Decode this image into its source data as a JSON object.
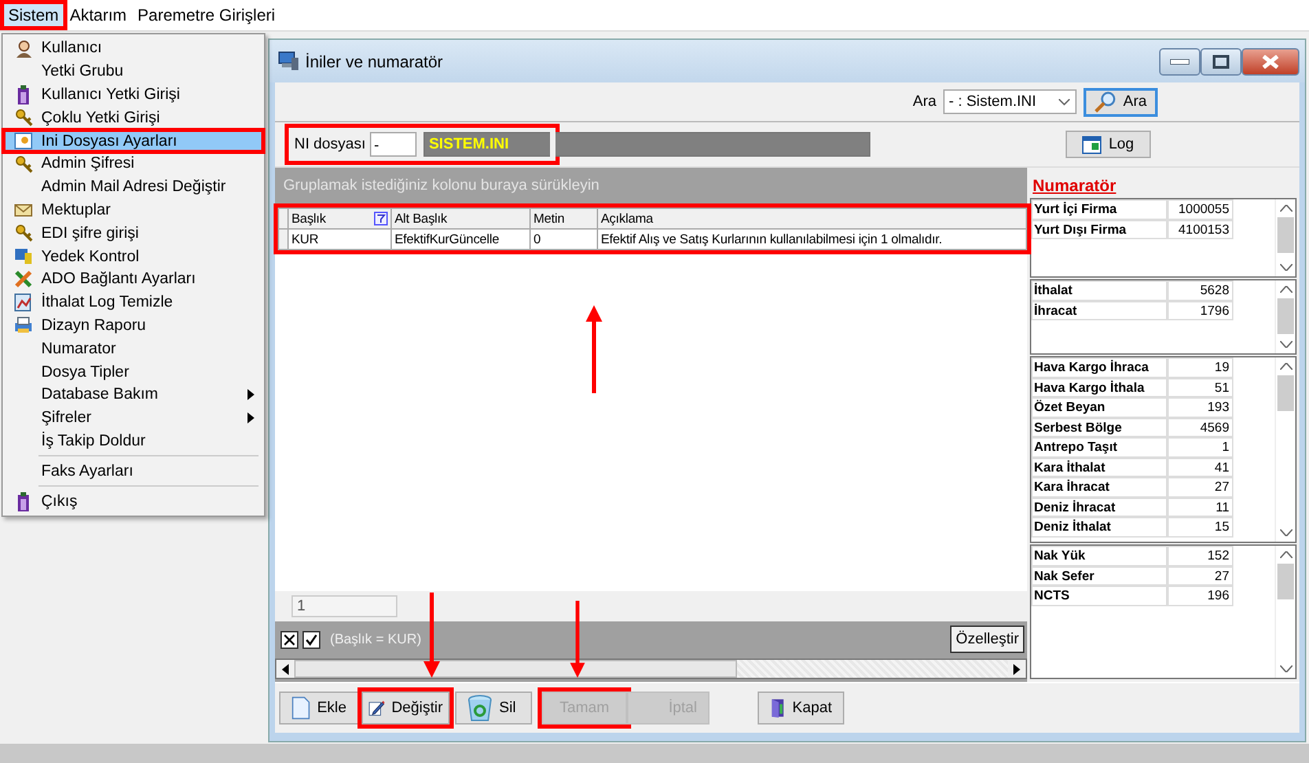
{
  "menu_bar": [
    {
      "label": "Sistem",
      "selected": true,
      "highlighted": true
    },
    {
      "label": "Aktarım",
      "selected": false,
      "highlighted": false
    },
    {
      "label": "Paremetre Girişleri",
      "selected": false,
      "highlighted": false
    }
  ],
  "menu": [
    {
      "kind": "item",
      "label": "Kullanıcı",
      "icon": true,
      "submenu": false,
      "selected": false,
      "highlighted": false
    },
    {
      "kind": "item",
      "label": "Yetki Grubu",
      "icon": false,
      "submenu": false,
      "selected": false,
      "highlighted": false
    },
    {
      "kind": "item",
      "label": "Kullanıcı Yetki Girişi",
      "icon": true,
      "submenu": false,
      "selected": false,
      "highlighted": false
    },
    {
      "kind": "item",
      "label": "Çoklu Yetki Girişi",
      "icon": true,
      "submenu": false,
      "selected": false,
      "highlighted": false
    },
    {
      "kind": "item",
      "label": "Ini Dosyası  Ayarları",
      "icon": true,
      "submenu": false,
      "selected": true,
      "highlighted": true
    },
    {
      "kind": "item",
      "label": "Admin Şifresi",
      "icon": true,
      "submenu": false,
      "selected": false,
      "highlighted": false
    },
    {
      "kind": "item",
      "label": "Admin Mail Adresi Değiştir",
      "icon": false,
      "submenu": false,
      "selected": false,
      "highlighted": false
    },
    {
      "kind": "item",
      "label": "Mektuplar",
      "icon": true,
      "submenu": false,
      "selected": false,
      "highlighted": false
    },
    {
      "kind": "item",
      "label": "EDI şifre girişi",
      "icon": true,
      "submenu": false,
      "selected": false,
      "highlighted": false
    },
    {
      "kind": "item",
      "label": "Yedek Kontrol",
      "icon": true,
      "submenu": false,
      "selected": false,
      "highlighted": false
    },
    {
      "kind": "item",
      "label": "ADO Bağlantı Ayarları",
      "icon": true,
      "submenu": false,
      "selected": false,
      "highlighted": false
    },
    {
      "kind": "item",
      "label": "İthalat Log Temizle",
      "icon": true,
      "submenu": false,
      "selected": false,
      "highlighted": false
    },
    {
      "kind": "item",
      "label": "Dizayn Raporu",
      "icon": true,
      "submenu": false,
      "selected": false,
      "highlighted": false
    },
    {
      "kind": "item",
      "label": "Numarator",
      "icon": false,
      "submenu": false,
      "selected": false,
      "highlighted": false
    },
    {
      "kind": "item",
      "label": "Dosya Tipler",
      "icon": false,
      "submenu": false,
      "selected": false,
      "highlighted": false
    },
    {
      "kind": "item",
      "label": "Database Bakım",
      "icon": false,
      "submenu": true,
      "selected": false,
      "highlighted": false
    },
    {
      "kind": "item",
      "label": "Şifreler",
      "icon": false,
      "submenu": true,
      "selected": false,
      "highlighted": false
    },
    {
      "kind": "item",
      "label": "İş Takip Doldur",
      "icon": false,
      "submenu": false,
      "selected": false,
      "highlighted": false
    },
    {
      "kind": "separator"
    },
    {
      "kind": "item",
      "label": "Faks Ayarları",
      "icon": false,
      "submenu": false,
      "selected": false,
      "highlighted": false
    },
    {
      "kind": "separator"
    },
    {
      "kind": "item",
      "label": "Çıkış",
      "icon": true,
      "submenu": false,
      "selected": false,
      "highlighted": false
    }
  ],
  "window": {
    "title": "İniler ve numaratör",
    "search": {
      "label": "Ara",
      "value": "- : Sistem.INI",
      "button": "Ara"
    },
    "ini": {
      "label": "NI dosyası",
      "value": "-",
      "file": "SISTEM.INI",
      "highlighted": true
    },
    "log_button": "Log",
    "grid": {
      "group_hint": "Gruplamak istediğiniz kolonu buraya sürükleyin",
      "highlighted": true,
      "arrow": true,
      "columns": [
        "Başlık",
        "Alt Başlık",
        "Metin",
        "Açıklama"
      ],
      "rows": [
        [
          "KUR",
          "EfektifKurGüncelle",
          "0",
          "Efektif Alış ve Satış Kurlarının kullanılabilmesi için 1 olmalıdır."
        ]
      ],
      "footer": "1",
      "filter": {
        "checked": true,
        "text": "(Başlık = KUR)",
        "button": "Özelleştir"
      }
    },
    "buttons": [
      {
        "label": "Ekle",
        "disabled": false,
        "highlighted": false,
        "arrow": false
      },
      {
        "label": "Değiştir",
        "disabled": false,
        "highlighted": true,
        "arrow": true
      },
      {
        "label": "Sil",
        "disabled": false,
        "highlighted": false,
        "arrow": false
      },
      {
        "label": "Tamam",
        "disabled": true,
        "highlighted": true,
        "arrow": true
      },
      {
        "label": "İptal",
        "disabled": true,
        "highlighted": false,
        "arrow": false
      },
      {
        "label": "Kapat",
        "disabled": false,
        "highlighted": false,
        "arrow": false
      }
    ],
    "numarator": {
      "title": "Numaratör",
      "lists": [
        [
          [
            "Yurt İçi Firma",
            "1000055"
          ],
          [
            "Yurt Dışı Firma",
            "4100153"
          ]
        ],
        [
          [
            "İthalat",
            "5628"
          ],
          [
            "İhracat",
            "1796"
          ]
        ],
        [
          [
            "Hava Kargo İhraca",
            "19"
          ],
          [
            "Hava Kargo İthala",
            "51"
          ],
          [
            "Özet Beyan",
            "193"
          ],
          [
            "Serbest Bölge",
            "4569"
          ],
          [
            "Antrepo Taşıt",
            "1"
          ],
          [
            "Kara İthalat",
            "41"
          ],
          [
            "Kara İhracat",
            "27"
          ],
          [
            "Deniz İhracat",
            "11"
          ],
          [
            "Deniz İthalat",
            "15"
          ]
        ],
        [
          [
            "Nak Yük",
            "152"
          ],
          [
            "Nak Sefer",
            "27"
          ],
          [
            "NCTS",
            "196"
          ]
        ]
      ]
    }
  }
}
